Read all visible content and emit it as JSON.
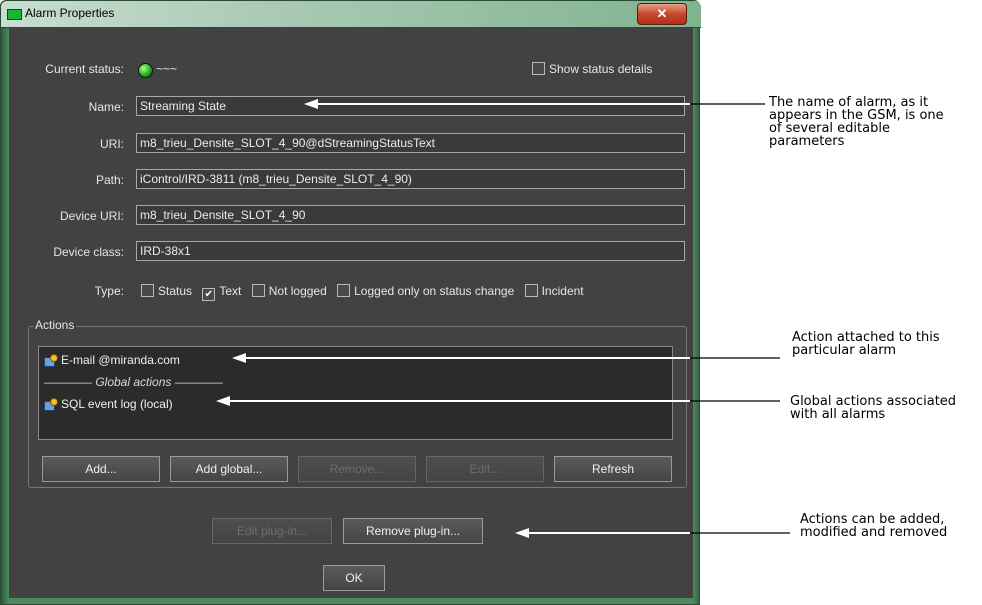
{
  "window": {
    "title": "Alarm Properties",
    "close_glyph": "✕"
  },
  "status": {
    "label": "Current status:",
    "value": "~~~",
    "indicator_color": "#22b01e",
    "show_details_label": "Show status details"
  },
  "fields": {
    "name": {
      "label": "Name:",
      "value": "Streaming State"
    },
    "uri": {
      "label": "URI:",
      "value": "m8_trieu_Densite_SLOT_4_90@dStreamingStatusText"
    },
    "path": {
      "label": "Path:",
      "value": "iControl/IRD-3811 (m8_trieu_Densite_SLOT_4_90)"
    },
    "device_uri": {
      "label": "Device URI:",
      "value": "m8_trieu_Densite_SLOT_4_90"
    },
    "device_class": {
      "label": "Device class:",
      "value": "IRD-38x1"
    }
  },
  "type": {
    "label": "Type:",
    "options": [
      {
        "label": "Status",
        "checked": false
      },
      {
        "label": "Text",
        "checked": true
      },
      {
        "label": "Not logged",
        "checked": false
      },
      {
        "label": "Logged only on status change",
        "checked": false
      },
      {
        "label": "Incident",
        "checked": false
      }
    ]
  },
  "actions": {
    "group_label": "Actions",
    "items": [
      "E-mail @miranda.com",
      "SQL event log (local)"
    ],
    "separator": "————  Global actions  ————",
    "buttons": {
      "add": "Add...",
      "add_global": "Add global...",
      "remove": "Remove...",
      "edit": "Edit...",
      "refresh": "Refresh"
    }
  },
  "plugin_buttons": {
    "edit": "Edit plug-in...",
    "remove": "Remove plug-in..."
  },
  "ok_label": "OK",
  "annotations": {
    "name": "The name of alarm, as it appears in the GSM, is one of several editable parameters",
    "name_lines": [
      "The name of alarm, as it",
      "appears in the GSM, is one",
      "of several editable",
      "parameters"
    ],
    "action": [
      "Action attached to this",
      "particular alarm"
    ],
    "global": [
      "Global actions associated",
      "with all alarms"
    ],
    "buttons": [
      "Actions can be added,",
      "modified and removed"
    ]
  }
}
